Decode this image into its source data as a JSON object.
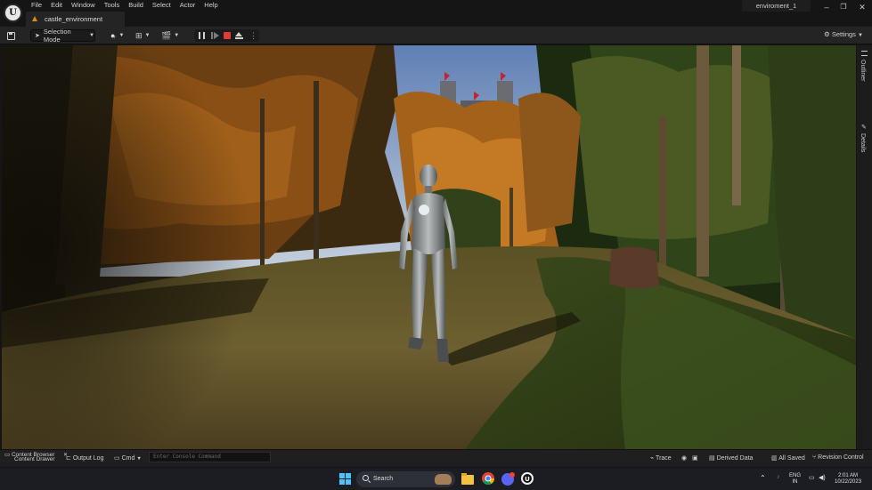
{
  "menu": {
    "items": [
      "File",
      "Edit",
      "Window",
      "Tools",
      "Build",
      "Select",
      "Actor",
      "Help"
    ]
  },
  "level_tab": {
    "label": "castle_environment"
  },
  "project_name": "enviroment_1",
  "window_controls": {
    "minimize": "–",
    "maximize": "❐",
    "close": "✕"
  },
  "toolbar": {
    "mode_label": "Selection Mode",
    "settings_label": "Settings"
  },
  "right_panel": {
    "outliner_label": "Outliner",
    "details_label": "Details"
  },
  "statusbar": {
    "content_browser": "Content Browser",
    "content_drawer": "Content Drawer",
    "output_log": "Output Log",
    "cmd": "Cmd",
    "console_placeholder": "Enter Console Command",
    "trace": "Trace",
    "derived_data": "Derived Data",
    "all_saved": "All Saved",
    "revision_control": "Revision Control"
  },
  "taskbar": {
    "search_label": "Search",
    "language_line1": "ENG",
    "language_line2": "IN",
    "time": "2:01 AM",
    "date": "10/22/2023"
  },
  "colors": {
    "accent_orange": "#d98c1a",
    "stop_red": "#e03a3a"
  }
}
